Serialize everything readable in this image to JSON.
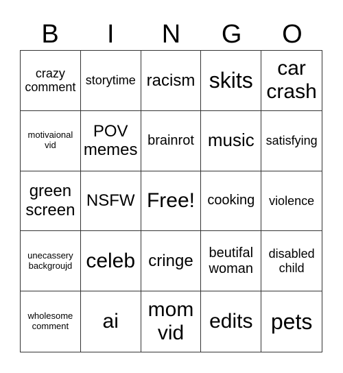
{
  "header": [
    "B",
    "I",
    "N",
    "G",
    "O"
  ],
  "cells": [
    "crazy comment",
    "storytime",
    "racism",
    "skits",
    "car crash",
    "motivaional vid",
    "POV memes",
    "brainrot",
    "music",
    "satisfying",
    "green screen",
    "NSFW",
    "Free!",
    "cooking",
    "violence",
    "unecassery backgroujd",
    "celeb",
    "cringe",
    "beutifal woman",
    "disabled child",
    "wholesome comment",
    "ai",
    "mom vid",
    "edits",
    "pets"
  ]
}
